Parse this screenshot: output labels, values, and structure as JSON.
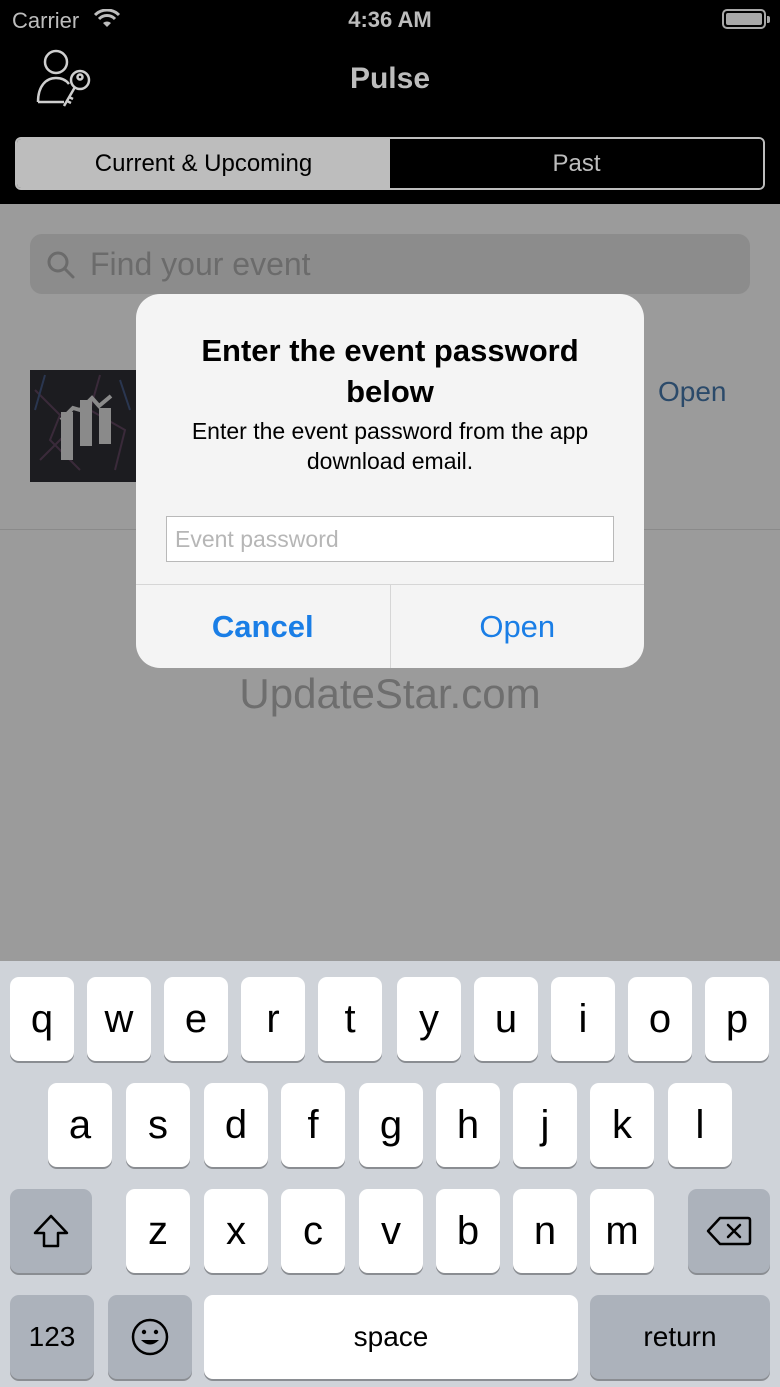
{
  "status_bar": {
    "carrier": "Carrier",
    "time": "4:36 AM"
  },
  "header": {
    "title": "Pulse"
  },
  "tabs": [
    {
      "label": "Current & Upcoming"
    },
    {
      "label": "Past"
    }
  ],
  "search": {
    "placeholder": "Find your event"
  },
  "event": {
    "open_label": "Open"
  },
  "watermark": "UpdateStar.com",
  "dialog": {
    "title": "Enter the event password below",
    "message": "Enter the event password from the app download email.",
    "input_placeholder": "Event password",
    "cancel_label": "Cancel",
    "open_label": "Open"
  },
  "keyboard": {
    "row1": [
      "q",
      "w",
      "e",
      "r",
      "t",
      "y",
      "u",
      "i",
      "o",
      "p"
    ],
    "row2": [
      "a",
      "s",
      "d",
      "f",
      "g",
      "h",
      "j",
      "k",
      "l"
    ],
    "row3": [
      "z",
      "x",
      "c",
      "v",
      "b",
      "n",
      "m"
    ],
    "numbers_label": "123",
    "space_label": "space",
    "return_label": "return"
  },
  "colors": {
    "accent": "#1a7ee6",
    "header_bg": "#000000",
    "dim_bg": "#9b9b9b"
  }
}
